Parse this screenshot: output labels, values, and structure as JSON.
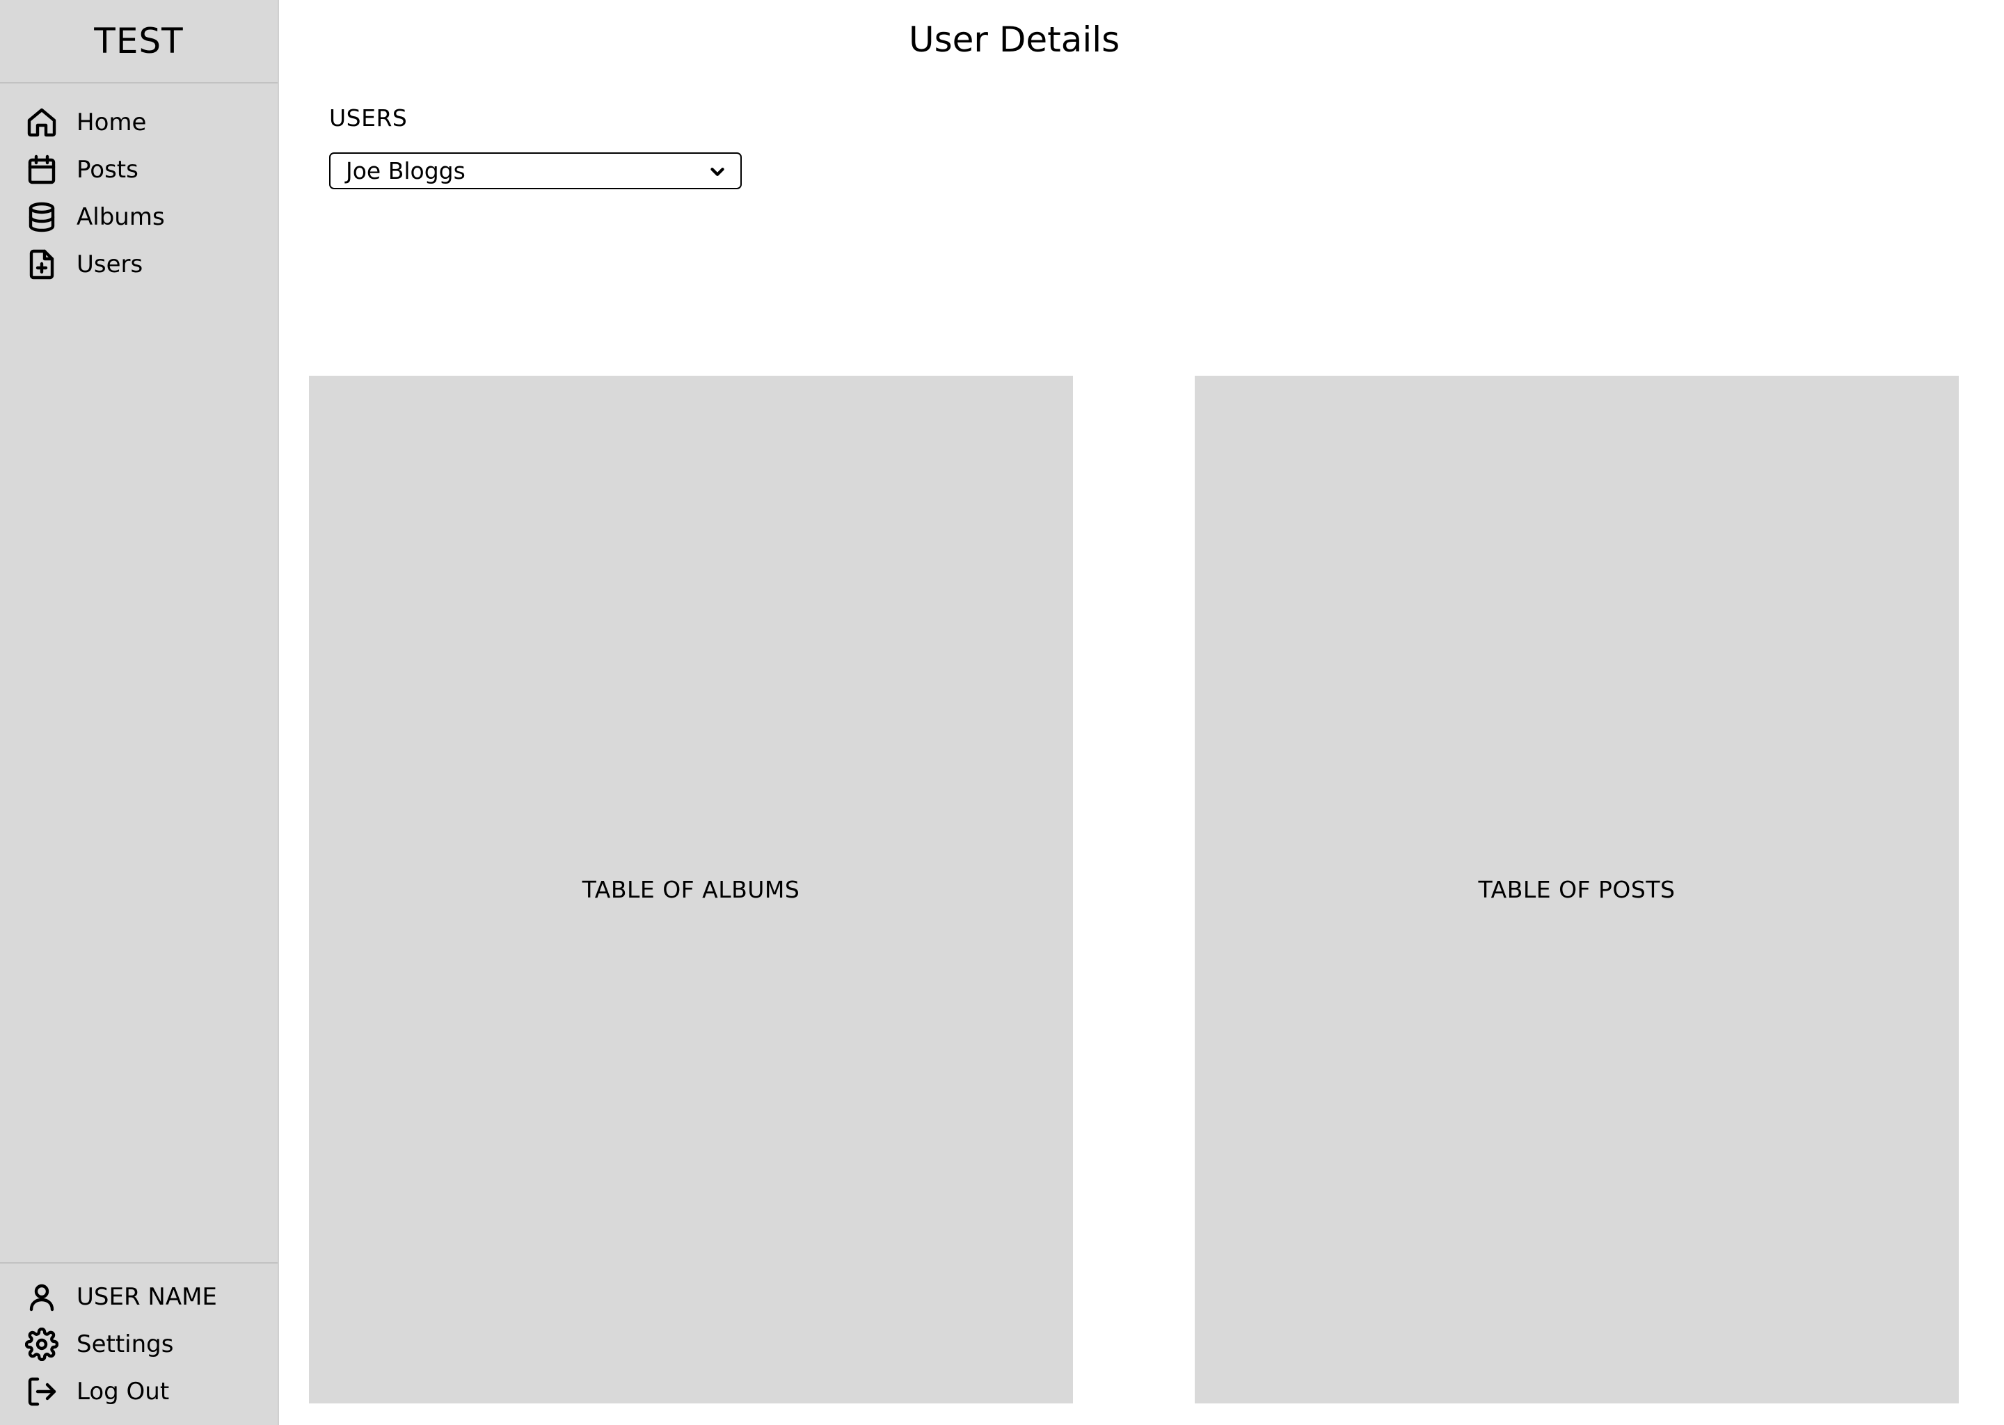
{
  "sidebar": {
    "brand": "TEST",
    "items": [
      {
        "label": "Home",
        "icon": "home-icon"
      },
      {
        "label": "Posts",
        "icon": "calendar-icon"
      },
      {
        "label": "Albums",
        "icon": "database-icon"
      },
      {
        "label": "Users",
        "icon": "file-plus-icon"
      }
    ],
    "bottom": [
      {
        "label": "USER NAME",
        "icon": "user-icon"
      },
      {
        "label": "Settings",
        "icon": "gear-icon"
      },
      {
        "label": "Log Out",
        "icon": "logout-icon"
      }
    ]
  },
  "main": {
    "title": "User Details",
    "users_label": "USERS",
    "selected_user": "Joe Bloggs",
    "panels": {
      "albums": "TABLE OF ALBUMS",
      "posts": "TABLE OF POSTS"
    }
  },
  "colors": {
    "sidebar_bg": "#d9d9d9",
    "panel_bg": "#d9d9d9",
    "page_bg": "#ffffff"
  }
}
